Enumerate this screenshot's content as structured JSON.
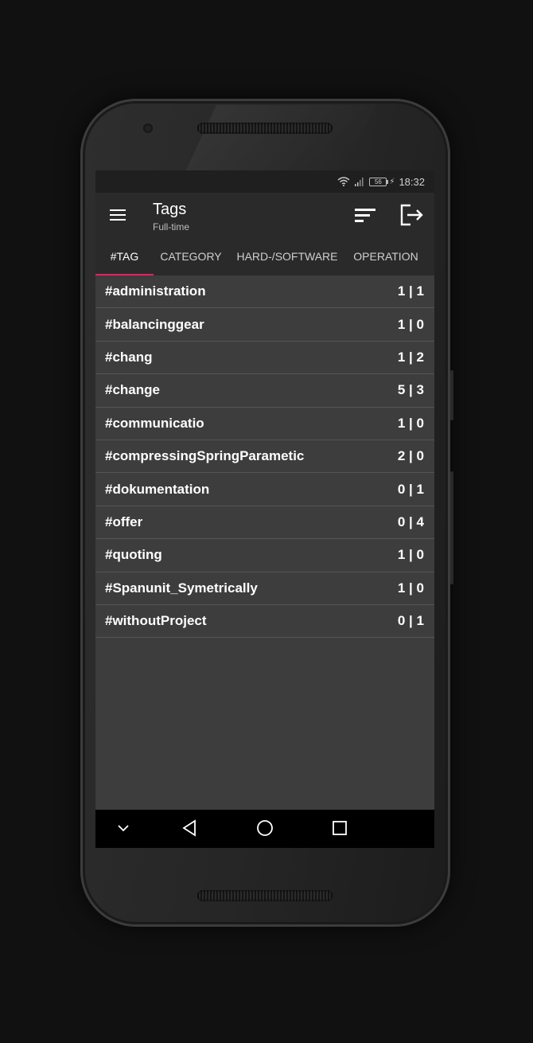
{
  "status": {
    "time": "18:32",
    "battery": "56"
  },
  "appbar": {
    "title": "Tags",
    "subtitle": "Full-time",
    "icons": [
      "menu-icon",
      "sort-icon",
      "logout-icon"
    ]
  },
  "tabs": [
    {
      "label": "#TAG",
      "active": true
    },
    {
      "label": "CATEGORY",
      "active": false
    },
    {
      "label": "HARD-/SOFTWARE",
      "active": false
    },
    {
      "label": "OPERATION",
      "active": false
    }
  ],
  "rows": [
    {
      "tag": "#administration",
      "count": "1 | 1"
    },
    {
      "tag": "#balancinggear",
      "count": "1 | 0"
    },
    {
      "tag": "#chang",
      "count": "1 | 2"
    },
    {
      "tag": "#change",
      "count": "5 | 3"
    },
    {
      "tag": "#communicatio",
      "count": "1 | 0"
    },
    {
      "tag": "#compressingSpringParametic",
      "count": "2 | 0"
    },
    {
      "tag": "#dokumentation",
      "count": "0 | 1"
    },
    {
      "tag": "#offer",
      "count": "0 | 4"
    },
    {
      "tag": "#quoting",
      "count": "1 | 0"
    },
    {
      "tag": "#Spanunit_Symetrically",
      "count": "1 | 0"
    },
    {
      "tag": "#withoutProject",
      "count": "0 | 1"
    }
  ],
  "navbar": {
    "icons": [
      "chevron-down-icon",
      "back-icon",
      "home-icon",
      "recents-icon"
    ]
  },
  "colors": {
    "accent": "#e91e63",
    "appbar": "#2a2a2a",
    "list_background": "#3d3d3d"
  }
}
